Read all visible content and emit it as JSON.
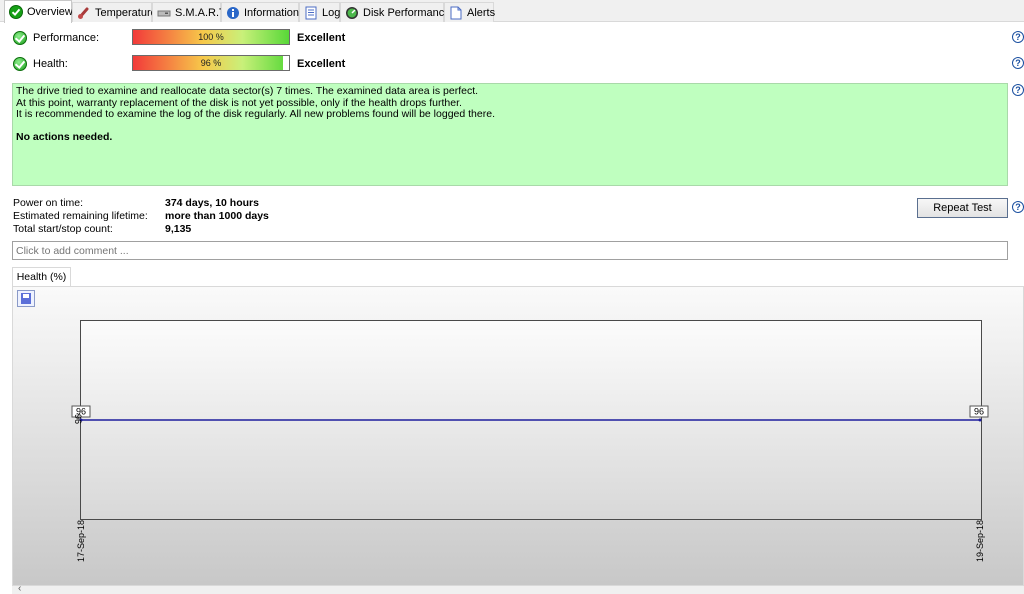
{
  "tabs": [
    {
      "label": "Overview",
      "icon": "check-circle-icon",
      "active": true
    },
    {
      "label": "Temperature",
      "icon": "thermometer-icon"
    },
    {
      "label": "S.M.A.R.T.",
      "icon": "drive-icon"
    },
    {
      "label": "Information",
      "icon": "info-icon"
    },
    {
      "label": "Log",
      "icon": "log-icon"
    },
    {
      "label": "Disk Performance",
      "icon": "gauge-icon"
    },
    {
      "label": "Alerts",
      "icon": "document-icon"
    }
  ],
  "status": {
    "performance": {
      "label": "Performance:",
      "percent": 100,
      "bar_text": "100 %",
      "rating": "Excellent"
    },
    "health": {
      "label": "Health:",
      "percent": 96,
      "bar_text": "96 %",
      "rating": "Excellent"
    }
  },
  "message": {
    "lines": [
      "The drive tried to examine and reallocate data sector(s) 7 times. The examined data area is perfect.",
      "At this point, warranty replacement of the disk is not yet possible, only if the health drops further.",
      "It is recommended to examine the log of the disk regularly. All new problems found will be logged there."
    ],
    "action": "No actions needed."
  },
  "info": {
    "power_on_label": "Power on time:",
    "power_on_value": "374 days, 10 hours",
    "lifetime_label": "Estimated remaining lifetime:",
    "lifetime_value": "more than 1000 days",
    "startstop_label": "Total start/stop count:",
    "startstop_value": "9,135"
  },
  "repeat_button": "Repeat Test",
  "comment_placeholder": "Click to add comment ...",
  "help_glyph": "?",
  "chart_tab": "Health (%)",
  "colors": {
    "series": "#1c1c9c",
    "message_bg": "#bfffbf"
  },
  "chart_data": {
    "type": "line",
    "x": [
      "17-Sep-18",
      "19-Sep-18"
    ],
    "series": [
      {
        "values": [
          96,
          96
        ]
      }
    ],
    "data_labels": [
      "96",
      "96"
    ],
    "ylabel_tick": "96",
    "grid": false
  }
}
